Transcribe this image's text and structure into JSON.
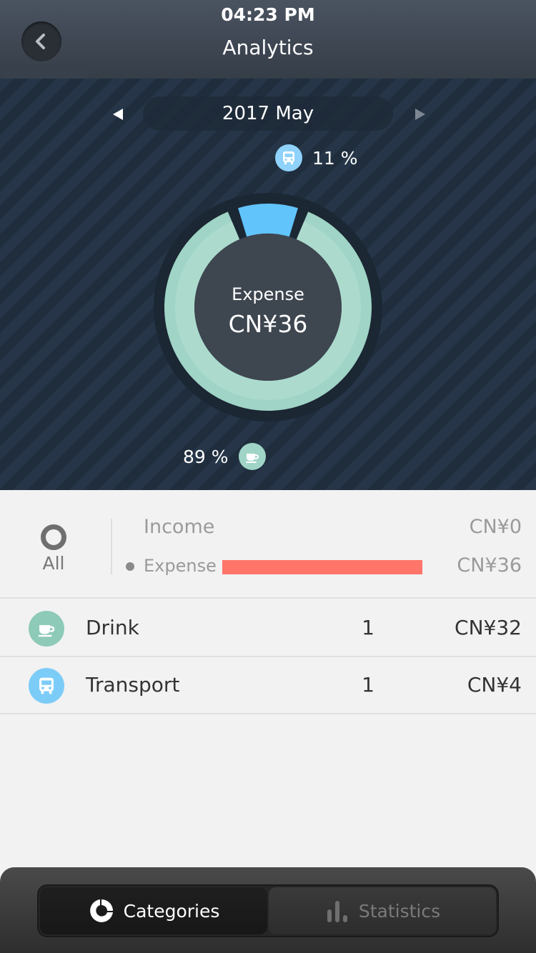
{
  "status": {
    "time": "04:23 PM"
  },
  "header": {
    "title": "Analytics",
    "back_icon": "chevron-left-icon"
  },
  "period": {
    "label": "2017 May"
  },
  "donut": {
    "center_label": "Expense",
    "center_value": "CN¥36",
    "transport_pct": "11 %",
    "drink_pct": "89 %",
    "slices": [
      {
        "category": "Drink",
        "percent": 89,
        "color": "#9fd4c6"
      },
      {
        "category": "Transport",
        "percent": 11,
        "color": "#61c4fb"
      }
    ]
  },
  "summary": {
    "all_label": "All",
    "income_label": "Income",
    "income_value": "CN¥0",
    "expense_label": "Expense",
    "expense_value": "CN¥36",
    "expense_bar_color": "#ff756a"
  },
  "categories": [
    {
      "name": "Drink",
      "count": "1",
      "amount": "CN¥32",
      "icon": "coffee-cup-icon",
      "color": "#8ecab8"
    },
    {
      "name": "Transport",
      "count": "1",
      "amount": "CN¥4",
      "icon": "bus-icon",
      "color": "#7cccf8"
    }
  ],
  "tabs": {
    "categories_label": "Categories",
    "statistics_label": "Statistics",
    "active": "categories"
  }
}
